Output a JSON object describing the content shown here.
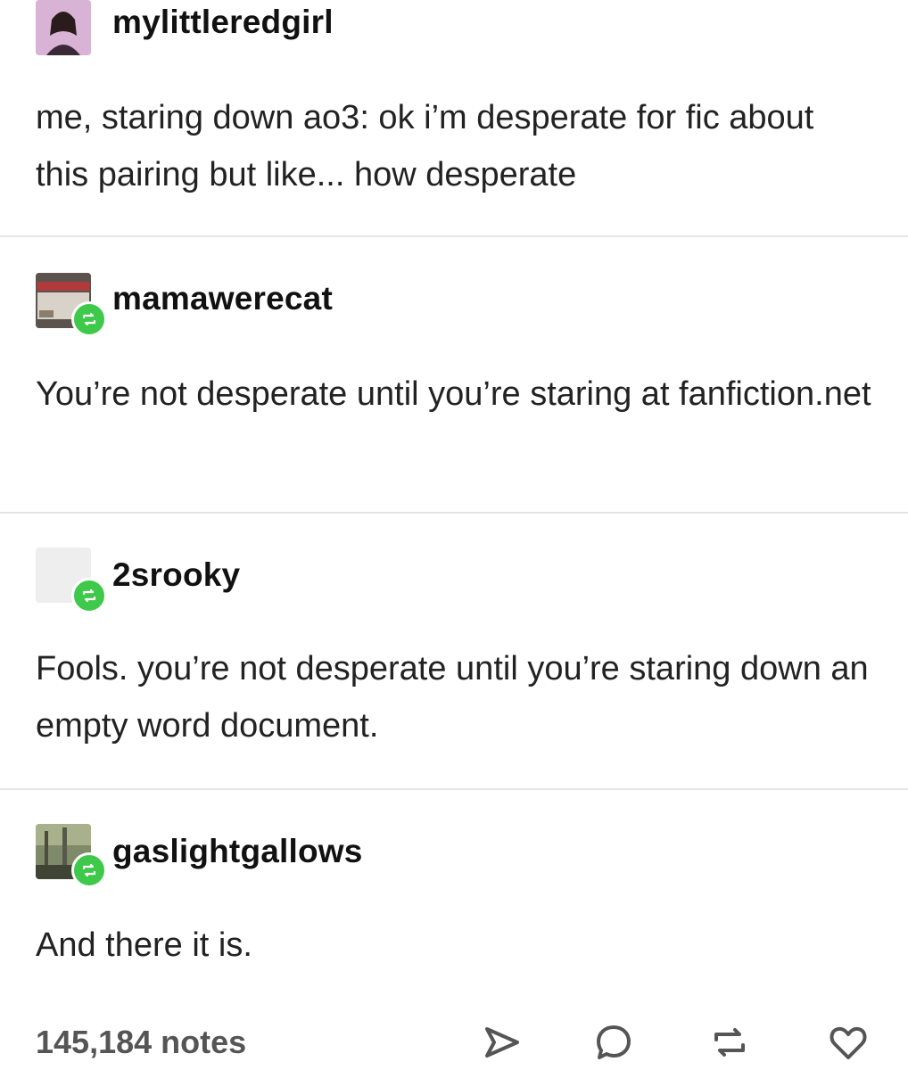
{
  "posts": [
    {
      "username": "mylittleredgirl",
      "avatar_icon": "profile-photo-pink",
      "text": "me, staring down ao3: ok i’m desperate for fic about this pairing but like... how desperate"
    },
    {
      "username": "mamawerecat",
      "avatar_icon": "warning-sign-photo",
      "reblog_icon": "reblog-icon",
      "text": "You’re not desperate until you’re staring at fanfiction.net"
    },
    {
      "username": "2srooky",
      "avatar_icon": "blank-avatar",
      "reblog_icon": "reblog-icon",
      "text": "Fools. you’re not desperate until you’re staring down an empty word document."
    },
    {
      "username": "gaslightgallows",
      "avatar_icon": "landscape-photo",
      "reblog_icon": "reblog-icon",
      "text": "And there it is."
    }
  ],
  "footer": {
    "notes": "145,184 notes",
    "actions": [
      "share-icon",
      "reply-icon",
      "reblog-icon",
      "like-icon"
    ]
  },
  "colors": {
    "reblog_badge": "#3ec94a",
    "divider": "#e5e5e5",
    "text": "#222222"
  }
}
